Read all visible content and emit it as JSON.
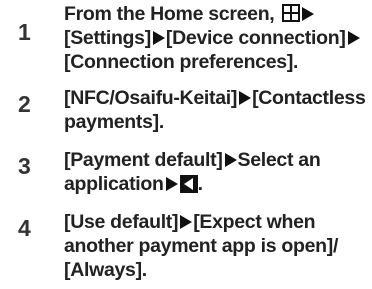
{
  "steps": [
    {
      "number": "1",
      "lines": [
        {
          "pre": "From the Home screen, ",
          "after_icon": ""
        },
        {
          "seg1": "[Settings]",
          "seg2": "[Device connection]"
        },
        {
          "text": "[Connection preferences]."
        }
      ],
      "icons": [
        "apps-icon",
        "arrow-icon"
      ]
    },
    {
      "number": "2",
      "lines": [
        {
          "seg1": "[NFC/Osaifu-Keitai]",
          "seg2": "[Contactless"
        },
        {
          "text": "payments]."
        }
      ]
    },
    {
      "number": "3",
      "lines": [
        {
          "seg1": "[Payment default]",
          "seg2": "Select an"
        },
        {
          "seg1": "application",
          "seg2": "."
        }
      ],
      "icons": [
        "back-icon"
      ]
    },
    {
      "number": "4",
      "lines": [
        {
          "seg1": "[Use default]",
          "seg2": "[Expect when"
        },
        {
          "text": "another payment app is open]/"
        },
        {
          "text": "[Always]."
        }
      ]
    }
  ]
}
